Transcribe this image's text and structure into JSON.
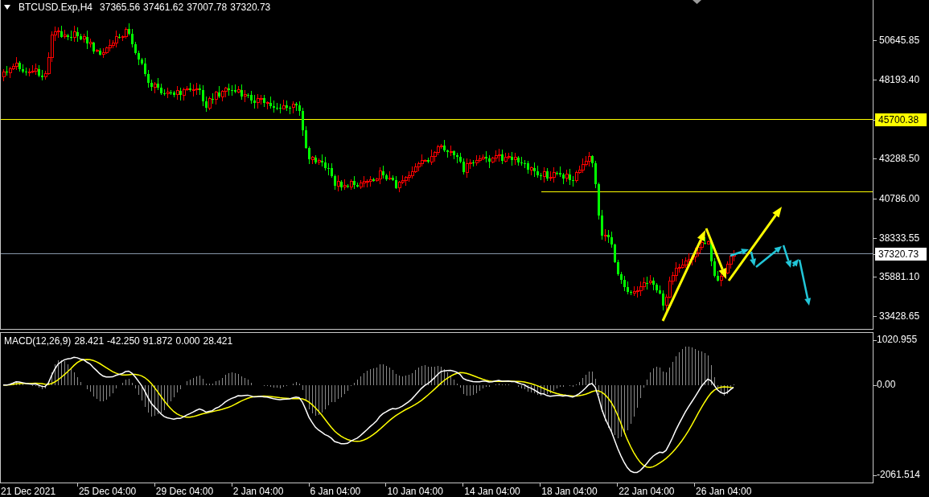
{
  "chart": {
    "symbol": "BTCUSD.Exp,H4",
    "ohlc": [
      "37365.56",
      "37461.62",
      "37007.78",
      "37320.73"
    ]
  },
  "price_axis": [
    {
      "label": "50645.85",
      "kind": "tick"
    },
    {
      "label": "48193.40",
      "kind": "tick"
    },
    {
      "label": "45700.38",
      "kind": "level"
    },
    {
      "label": "43288.50",
      "kind": "tick"
    },
    {
      "label": "40786.00",
      "kind": "tick"
    },
    {
      "label": "38333.55",
      "kind": "tick"
    },
    {
      "label": "37320.73",
      "kind": "current"
    },
    {
      "label": "35881.10",
      "kind": "tick"
    },
    {
      "label": "33428.65",
      "kind": "tick"
    }
  ],
  "indicator": {
    "name": "MACD(12,26,9)",
    "values": [
      "28.421",
      "-42.250",
      "91.872",
      "0.000",
      "28.421"
    ],
    "axis": [
      "1020.955",
      "0.00",
      "-2061.514"
    ]
  },
  "time_axis": [
    "21 Dec 2021",
    "25 Dec 04:00",
    "29 Dec 04:00",
    "2 Jan 04:00",
    "6 Jan 04:00",
    "10 Jan 04:00",
    "14 Jan 04:00",
    "18 Jan 04:00",
    "22 Jan 04:00",
    "26 Jan 04:00"
  ]
}
